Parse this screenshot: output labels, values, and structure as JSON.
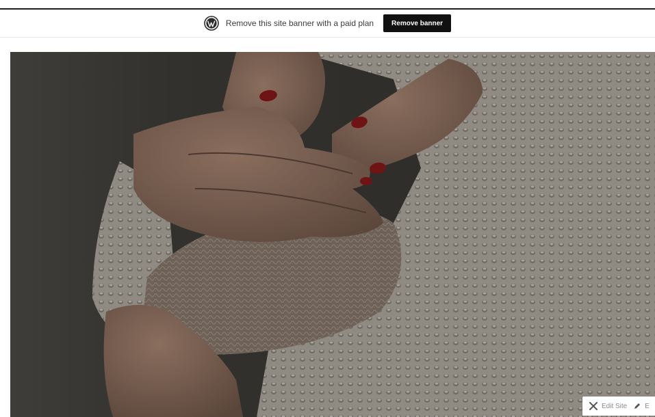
{
  "banner": {
    "message": "Remove this site banner with a paid plan",
    "button_label": "Remove banner",
    "logo_icon": "wordpress-logo-icon"
  },
  "hero": {
    "image_subject": "mother-holding-baby-in-knit-sweater-photo"
  },
  "edit_bar": {
    "edit_site_label": "Edit Site",
    "edit_site_icon": "tools-icon",
    "edit_label": "E",
    "edit_icon": "pencil-icon"
  },
  "colors": {
    "banner_button_bg": "#111111",
    "top_rule": "#1d1d1d",
    "nail_polish": "#6e1414"
  }
}
